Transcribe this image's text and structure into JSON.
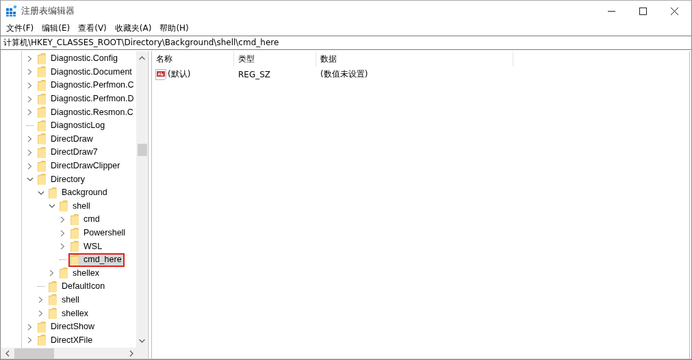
{
  "window": {
    "title": "注册表编辑器"
  },
  "menu": [
    "文件(F)",
    "编辑(E)",
    "查看(V)",
    "收藏夹(A)",
    "帮助(H)"
  ],
  "address": "计算机\\HKEY_CLASSES_ROOT\\Directory\\Background\\shell\\cmd_here",
  "tree": [
    {
      "label": "Diagnostic.Config",
      "kind": "branch",
      "expanded": false,
      "selected": false
    },
    {
      "label": "Diagnostic.Document",
      "kind": "branch",
      "expanded": false,
      "selected": false
    },
    {
      "label": "Diagnostic.Perfmon.C",
      "kind": "branch",
      "expanded": false,
      "selected": false
    },
    {
      "label": "Diagnostic.Perfmon.D",
      "kind": "branch",
      "expanded": false,
      "selected": false
    },
    {
      "label": "Diagnostic.Resmon.C",
      "kind": "branch",
      "expanded": false,
      "selected": false
    },
    {
      "label": "DiagnosticLog",
      "kind": "leaf",
      "selected": false
    },
    {
      "label": "DirectDraw",
      "kind": "branch",
      "expanded": false,
      "selected": false
    },
    {
      "label": "DirectDraw7",
      "kind": "branch",
      "expanded": false,
      "selected": false
    },
    {
      "label": "DirectDrawClipper",
      "kind": "branch",
      "expanded": false,
      "selected": false
    },
    {
      "label": "Directory",
      "kind": "branch",
      "expanded": true,
      "selected": false,
      "children": [
        {
          "label": "Background",
          "kind": "branch",
          "expanded": true,
          "selected": false,
          "children": [
            {
              "label": "shell",
              "kind": "branch",
              "expanded": true,
              "selected": false,
              "children": [
                {
                  "label": "cmd",
                  "kind": "branch",
                  "expanded": false,
                  "selected": false
                },
                {
                  "label": "Powershell",
                  "kind": "branch",
                  "expanded": false,
                  "selected": false
                },
                {
                  "label": "WSL",
                  "kind": "branch",
                  "expanded": false,
                  "selected": false
                },
                {
                  "label": "cmd_here",
                  "kind": "leaf",
                  "selected": true,
                  "annotated": true
                }
              ]
            },
            {
              "label": "shellex",
              "kind": "branch",
              "expanded": false,
              "selected": false
            }
          ]
        },
        {
          "label": "DefaultIcon",
          "kind": "leaf",
          "selected": false
        },
        {
          "label": "shell",
          "kind": "branch",
          "expanded": false,
          "selected": false
        },
        {
          "label": "shellex",
          "kind": "branch",
          "expanded": false,
          "selected": false
        }
      ]
    },
    {
      "label": "DirectShow",
      "kind": "branch",
      "expanded": false,
      "selected": false
    },
    {
      "label": "DirectXFile",
      "kind": "branch",
      "expanded": false,
      "selected": false
    }
  ],
  "values": {
    "columns": [
      "名称",
      "类型",
      "数据"
    ],
    "rows": [
      {
        "name": "(默认)",
        "type": "REG_SZ",
        "data": "(数值未设置)"
      }
    ]
  }
}
